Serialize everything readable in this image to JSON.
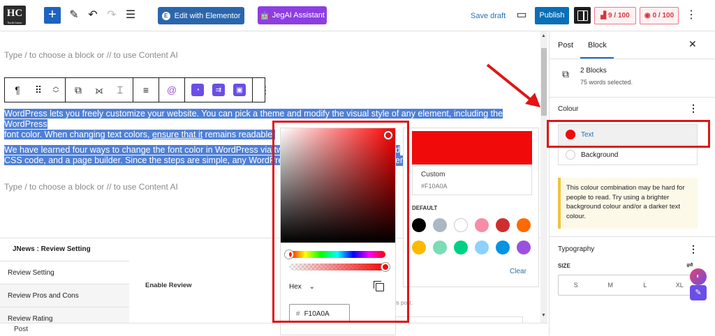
{
  "topbar": {
    "logo_text": "HC",
    "logo_sub": "North Center",
    "elementor_label": "Edit with Elementor",
    "jegai_label": "JegAI Assistant",
    "save_draft": "Save draft",
    "publish": "Publish",
    "seo_score": "9 / 100",
    "readability_score": "0 / 100"
  },
  "editor": {
    "placeholder_top": "Type / to choose a block or // to use Content AI",
    "para1_line1": "WordPress lets you freely customize your website. You can pick a theme and modify the visual style of any element, including the WordPress",
    "para1_line2_a": "font color. When changing text colors, ",
    "para1_line2_b": "ensure that it",
    "para1_line2_c": " remains readable.",
    "para2_line1": "We have learned four ways to change the font color in WordPress via two V",
    "para2_line1_tail": "rd",
    "para2_line2": "CSS code, and a page builder. Since the steps are simple, any WordPress",
    "para2_line2_tail": "em",
    "placeholder_bottom": "Type / to choose a block or // to use Content AI"
  },
  "meta": {
    "title": "JNews : Review Setting",
    "tabs": [
      "Review Setting",
      "Review Pros and Cons",
      "Review Rating"
    ],
    "enable_review": "Enable Review",
    "hint_fragment": "is post."
  },
  "footer": {
    "breadcrumb": "Post"
  },
  "picker": {
    "format": "Hex",
    "hex_value": "F10A0A",
    "hex_prefix": "#",
    "hue_pos": 0.0,
    "alpha": 1.0
  },
  "palette": {
    "custom_label": "Custom",
    "custom_hex": "#F10A0A",
    "custom_color": "#f10a0a",
    "default_label": "DEFAULT",
    "clear_label": "Clear",
    "swatches": [
      "#000000",
      "#abb8c3",
      "#ffffff",
      "#f78da7",
      "#cf2e2e",
      "#ff6900",
      "#fcb900",
      "#7bdcb5",
      "#00d084",
      "#8ed1fc",
      "#0693e3",
      "#9b51e0"
    ]
  },
  "sidebar": {
    "tab_post": "Post",
    "tab_block": "Block",
    "blocks_title": "2 Blocks",
    "blocks_sub": "75 words selected.",
    "colour_title": "Colour",
    "text_label": "Text",
    "text_color": "#f10a0a",
    "background_label": "Background",
    "warning": "This colour combination may be hard for people to read. Try using a brighter background colour and/or a darker text colour.",
    "typography_title": "Typography",
    "size_label": "SIZE",
    "sizes": [
      "S",
      "M",
      "L",
      "XL"
    ]
  }
}
